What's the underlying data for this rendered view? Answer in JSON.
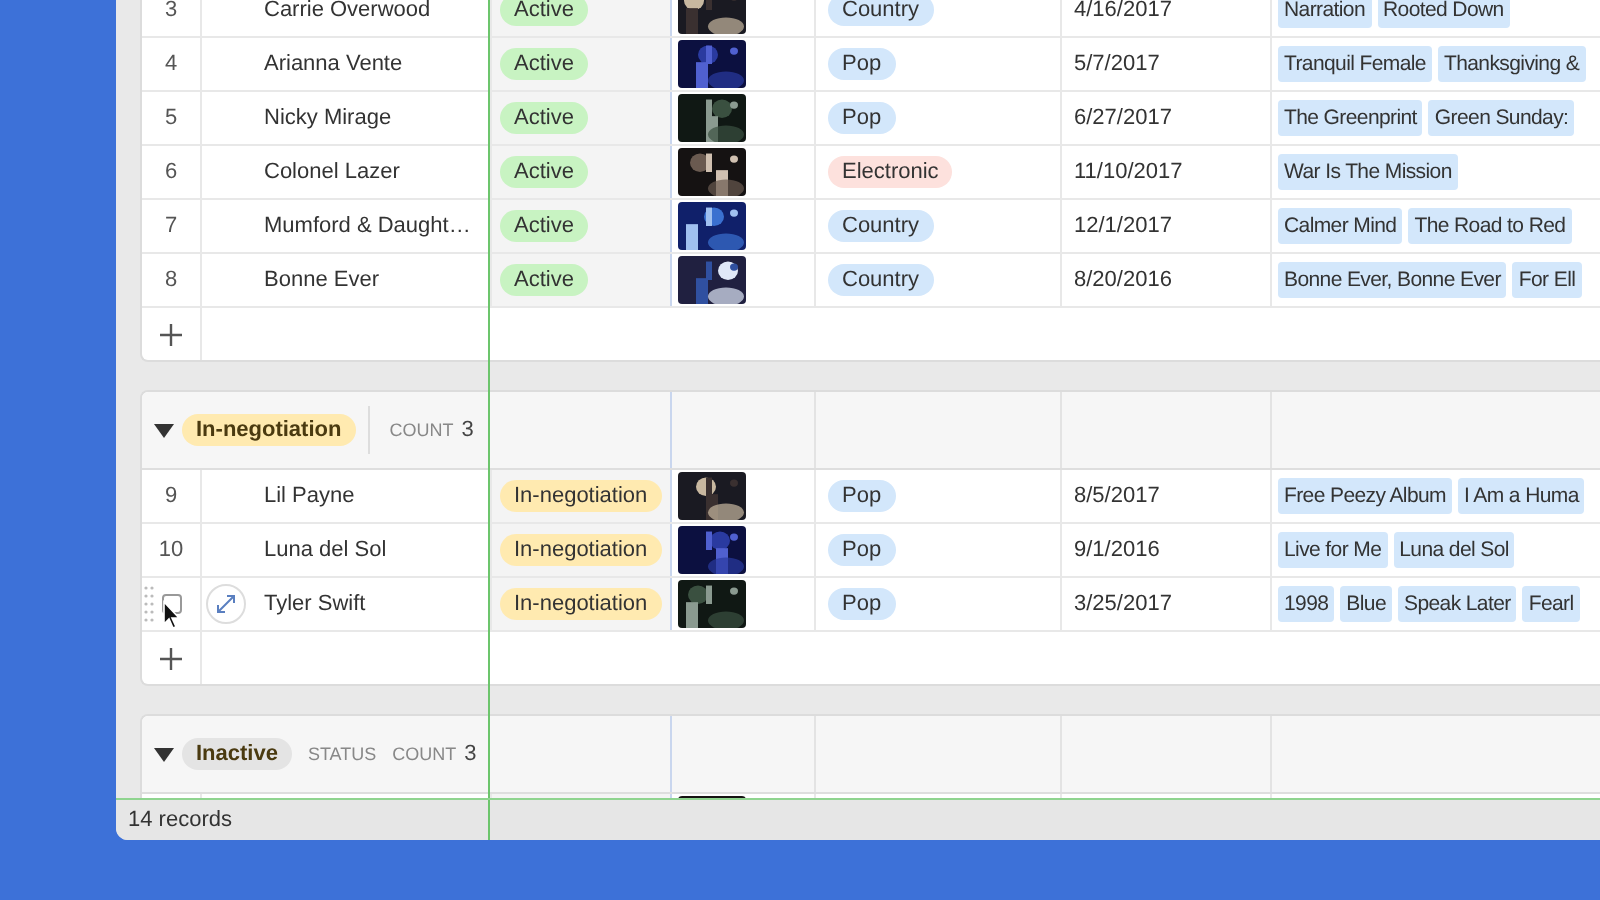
{
  "groups": [
    {
      "rows": [
        {
          "hovered": false,
          "number": "3",
          "name": "Carrie Overwood",
          "status": {
            "label": "Active",
            "color": "#c8f3c2"
          },
          "photo": {
            "kind": "picture"
          },
          "genre": {
            "label": "Country",
            "color": "#d3e7fb"
          },
          "date": "4/16/2017",
          "albums": [
            "Narration",
            "Rooted Down"
          ]
        },
        {
          "hovered": false,
          "number": "4",
          "name": "Arianna Vente",
          "status": {
            "label": "Active",
            "color": "#c8f3c2"
          },
          "photo": {
            "kind": "picture"
          },
          "genre": {
            "label": "Pop",
            "color": "#d3e7fb"
          },
          "date": "5/7/2017",
          "albums": [
            "Tranquil Female",
            "Thanksgiving &"
          ]
        },
        {
          "hovered": false,
          "number": "5",
          "name": "Nicky Mirage",
          "status": {
            "label": "Active",
            "color": "#c8f3c2"
          },
          "photo": {
            "kind": "picture"
          },
          "genre": {
            "label": "Pop",
            "color": "#d3e7fb"
          },
          "date": "6/27/2017",
          "albums": [
            "The Greenprint",
            "Green Sunday:"
          ]
        },
        {
          "hovered": false,
          "number": "6",
          "name": "Colonel Lazer",
          "status": {
            "label": "Active",
            "color": "#c8f3c2"
          },
          "photo": {
            "kind": "picture"
          },
          "genre": {
            "label": "Electronic",
            "color": "#fde1dd"
          },
          "date": "11/10/2017",
          "albums": [
            "War Is The Mission"
          ]
        },
        {
          "hovered": false,
          "number": "7",
          "name": "Mumford & Daught…",
          "status": {
            "label": "Active",
            "color": "#c8f3c2"
          },
          "photo": {
            "kind": "picture"
          },
          "genre": {
            "label": "Country",
            "color": "#d3e7fb"
          },
          "date": "12/1/2017",
          "albums": [
            "Calmer Mind",
            "The Road to Red"
          ]
        },
        {
          "hovered": false,
          "number": "8",
          "name": "Bonne Ever",
          "status": {
            "label": "Active",
            "color": "#c8f3c2"
          },
          "photo": {
            "kind": "picture"
          },
          "genre": {
            "label": "Country",
            "color": "#d3e7fb"
          },
          "date": "8/20/2016",
          "albums": [
            "Bonne Ever, Bonne Ever",
            "For Ell"
          ]
        }
      ]
    },
    {
      "header": {
        "expanded": true,
        "label": "In-negotiation",
        "color": "#ffeab0",
        "count_label": "COUNT",
        "count": "3"
      },
      "rows": [
        {
          "hovered": false,
          "number": "9",
          "name": "Lil Payne",
          "status": {
            "label": "In-negotiation",
            "color": "#ffeab0"
          },
          "photo": {
            "kind": "picture"
          },
          "genre": {
            "label": "Pop",
            "color": "#d3e7fb"
          },
          "date": "8/5/2017",
          "albums": [
            "Free Peezy Album",
            "I Am a Huma"
          ]
        },
        {
          "hovered": false,
          "number": "10",
          "name": "Luna del Sol",
          "status": {
            "label": "In-negotiation",
            "color": "#ffeab0"
          },
          "photo": {
            "kind": "picture"
          },
          "genre": {
            "label": "Pop",
            "color": "#d3e7fb"
          },
          "date": "9/1/2016",
          "albums": [
            "Live for Me",
            "Luna del Sol"
          ]
        },
        {
          "hovered": true,
          "checked": false,
          "name": "Tyler Swift",
          "status": {
            "label": "In-negotiation",
            "color": "#ffeab0"
          },
          "photo": {
            "kind": "picture"
          },
          "genre": {
            "label": "Pop",
            "color": "#d3e7fb"
          },
          "date": "3/25/2017",
          "albums": [
            "1998",
            "Blue",
            "Speak Later",
            "Fearl"
          ]
        }
      ]
    },
    {
      "header": {
        "expanded": true,
        "label": "Inactive",
        "color": "#e4e4e4",
        "field_label": "STATUS",
        "count_label": "COUNT",
        "count": "3"
      },
      "rows": [
        {
          "photo": {
            "kind": "picture"
          }
        }
      ]
    }
  ],
  "status_bar": {
    "records": "14 records"
  }
}
